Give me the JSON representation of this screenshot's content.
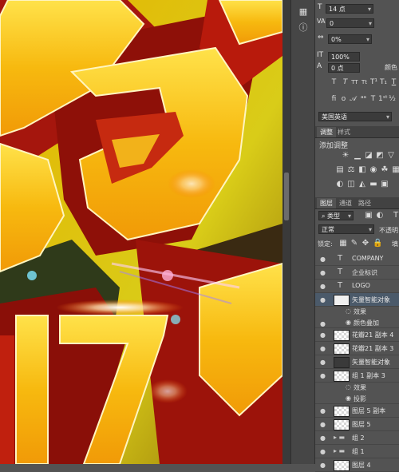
{
  "character": {
    "font_size": "14 点",
    "tracking_value": "0",
    "baseline": "0%",
    "vertical_scale": "100%",
    "baseline_shift": "0 点",
    "color_label": "颜色",
    "language": "美国英语"
  },
  "adjustments": {
    "tabs": [
      "调整",
      "样式"
    ],
    "title": "添加调整"
  },
  "layers_panel": {
    "tabs": [
      "图层",
      "通道",
      "路径"
    ],
    "filter_kind": "类型",
    "blend_mode": "正常",
    "opacity_label": "不透明",
    "lock_label": "锁定:",
    "fill_label": "填",
    "layers": [
      {
        "name": "COMPANY",
        "kind": "text"
      },
      {
        "name": "企业标识",
        "kind": "text"
      },
      {
        "name": "LOGO",
        "kind": "text"
      },
      {
        "name": "矢量智能对象",
        "kind": "smart",
        "selected": true
      },
      {
        "name": "效果",
        "kind": "effects"
      },
      {
        "name": "颜色叠加",
        "kind": "effect"
      },
      {
        "name": "花瓣21 副本 4",
        "kind": "image"
      },
      {
        "name": "花瓣21 副本 3",
        "kind": "image"
      },
      {
        "name": "矢量智能对象",
        "kind": "smart"
      },
      {
        "name": "组 1 副本 3",
        "kind": "image"
      },
      {
        "name": "效果",
        "kind": "effects"
      },
      {
        "name": "投影",
        "kind": "effect"
      },
      {
        "name": "图层 5 副本",
        "kind": "image"
      },
      {
        "name": "图层 5",
        "kind": "image"
      },
      {
        "name": "组 2",
        "kind": "group"
      },
      {
        "name": "组 1",
        "kind": "group"
      },
      {
        "name": "图层 4",
        "kind": "image"
      }
    ]
  },
  "colors": {
    "panel_bg": "#535353",
    "selection": "#4b5a6a",
    "gold": "#f5c21a",
    "red": "#b3180c"
  }
}
